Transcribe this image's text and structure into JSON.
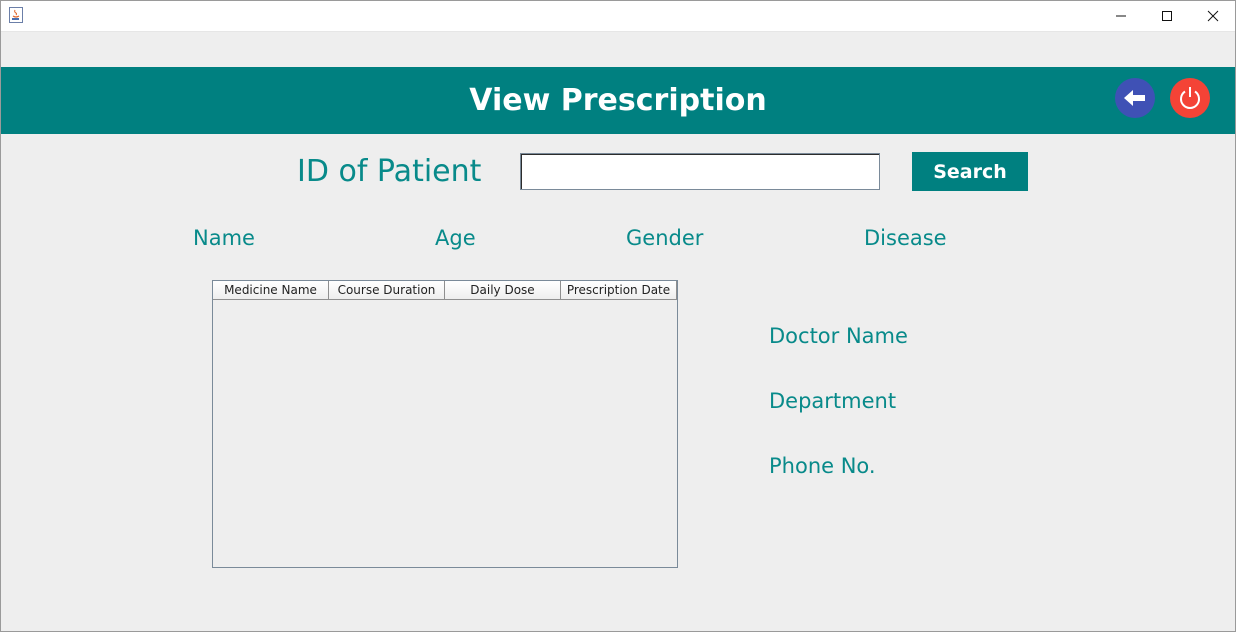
{
  "window": {
    "app_icon": "java-cup-icon",
    "controls": {
      "minimize_icon": "minimize-icon",
      "maximize_icon": "maximize-icon",
      "close_icon": "close-icon"
    }
  },
  "header": {
    "title": "View Prescription",
    "background": "#008080",
    "back_button_color": "#3f51b5",
    "power_button_color": "#f44336"
  },
  "search": {
    "label": "ID of Patient",
    "input_value": "",
    "button_label": "Search"
  },
  "patient": {
    "name_label": "Name",
    "age_label": "Age",
    "gender_label": "Gender",
    "disease_label": "Disease"
  },
  "table": {
    "columns": [
      "Medicine Name",
      "Course Duration",
      "Daily Dose",
      "Prescription Date"
    ],
    "rows": []
  },
  "doctor": {
    "name_label": "Doctor Name",
    "department_label": "Department",
    "phone_label": "Phone No."
  },
  "colors": {
    "accent": "#008080",
    "label_text": "#088a8a",
    "page_bg": "#eeeeee"
  }
}
